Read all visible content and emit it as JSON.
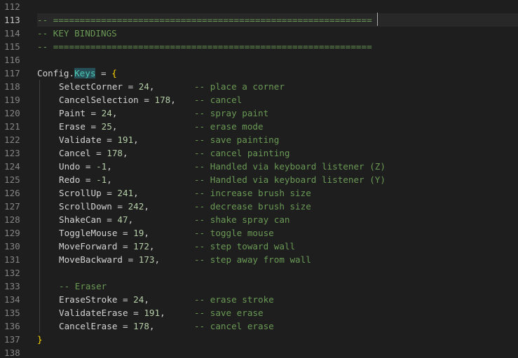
{
  "editor": {
    "lines": [
      {
        "num": "112",
        "kind": "empty"
      },
      {
        "num": "113",
        "kind": "comment",
        "text": "-- ============================================================",
        "current": true
      },
      {
        "num": "114",
        "kind": "comment",
        "text": "-- KEY BINDINGS"
      },
      {
        "num": "115",
        "kind": "comment",
        "text": "-- ============================================================"
      },
      {
        "num": "116",
        "kind": "empty"
      },
      {
        "num": "117",
        "kind": "config",
        "obj": "Config",
        "dot": ".",
        "prop": "Keys",
        "op": " = ",
        "brace": "{"
      },
      {
        "num": "118",
        "kind": "entry",
        "key": "SelectCorner",
        "val": "24",
        "comment": "-- place a corner"
      },
      {
        "num": "119",
        "kind": "entry",
        "key": "CancelSelection",
        "val": "178",
        "comment": "-- cancel"
      },
      {
        "num": "120",
        "kind": "entry",
        "key": "Paint",
        "val": "24",
        "comment": "-- spray paint"
      },
      {
        "num": "121",
        "kind": "entry",
        "key": "Erase",
        "val": "25",
        "comment": "-- erase mode"
      },
      {
        "num": "122",
        "kind": "entry",
        "key": "Validate",
        "val": "191",
        "comment": "-- save painting"
      },
      {
        "num": "123",
        "kind": "entry",
        "key": "Cancel",
        "val": "178",
        "comment": "-- cancel painting"
      },
      {
        "num": "124",
        "kind": "entry",
        "key": "Undo",
        "val": "-1",
        "comment": "-- Handled via keyboard listener (Z)"
      },
      {
        "num": "125",
        "kind": "entry",
        "key": "Redo",
        "val": "-1",
        "comment": "-- Handled via keyboard listener (Y)"
      },
      {
        "num": "126",
        "kind": "entry",
        "key": "ScrollUp",
        "val": "241",
        "comment": "-- increase brush size"
      },
      {
        "num": "127",
        "kind": "entry",
        "key": "ScrollDown",
        "val": "242",
        "comment": "-- decrease brush size"
      },
      {
        "num": "128",
        "kind": "entry",
        "key": "ShakeCan",
        "val": "47",
        "comment": "-- shake spray can"
      },
      {
        "num": "129",
        "kind": "entry",
        "key": "ToggleMouse",
        "val": "19",
        "comment": "-- toggle mouse"
      },
      {
        "num": "130",
        "kind": "entry",
        "key": "MoveForward",
        "val": "172",
        "comment": "-- step toward wall"
      },
      {
        "num": "131",
        "kind": "entry",
        "key": "MoveBackward",
        "val": "173",
        "comment": "-- step away from wall"
      },
      {
        "num": "132",
        "kind": "empty"
      },
      {
        "num": "133",
        "kind": "subcomment",
        "text": "-- Eraser"
      },
      {
        "num": "134",
        "kind": "entry",
        "key": "EraseStroke",
        "val": "24",
        "comment": "-- erase stroke"
      },
      {
        "num": "135",
        "kind": "entry",
        "key": "ValidateErase",
        "val": "191",
        "comment": "-- save erase"
      },
      {
        "num": "136",
        "kind": "entry",
        "key": "CancelErase",
        "val": "178",
        "comment": "-- cancel erase"
      },
      {
        "num": "137",
        "kind": "close",
        "brace": "}"
      },
      {
        "num": "138",
        "kind": "empty"
      }
    ]
  },
  "colors": {
    "background": "#1e1e1e",
    "comment": "#6a9955",
    "number": "#b5cea8",
    "brace": "#ffd700",
    "highlight": "#264f58"
  }
}
